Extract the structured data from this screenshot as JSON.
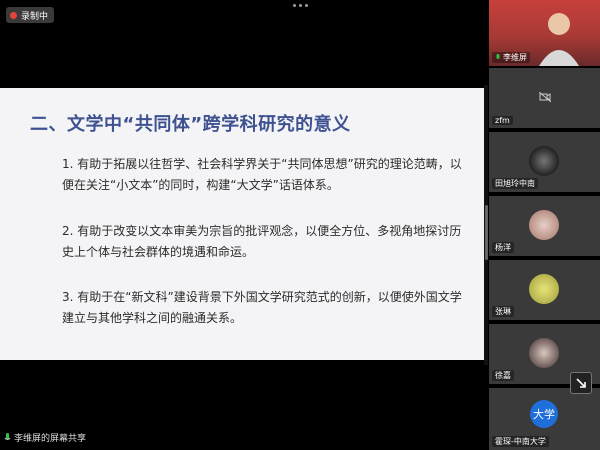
{
  "recording": {
    "label": "录制中"
  },
  "slide": {
    "title": "二、文学中“共同体”跨学科研究的意义",
    "points": [
      "1. 有助于拓展以往哲学、社会科学界关于“共同体思想”研究的理论范畴，以便在关注“小文本”的同时，构建“大文学”话语体系。",
      "2. 有助于改变以文本审美为宗旨的批评观念，以便全方位、多视角地探讨历史上个体与社会群体的境遇和命运。",
      "3. 有助于在“新文科”建设背景下外国文学研究范式的创新，以便使外国文学建立与其他学科之间的融通关系。"
    ]
  },
  "share_label": "李维屏的屏幕共享",
  "participants": [
    {
      "name": "李维屏",
      "icon": "person-video-icon"
    },
    {
      "name": "zfm",
      "icon": "camera-off-icon"
    },
    {
      "name": "田旭玲中南",
      "icon": "avatar-icon"
    },
    {
      "name": "杨洋",
      "icon": "avatar-icon"
    },
    {
      "name": "张琳",
      "icon": "avatar-icon"
    },
    {
      "name": "徐嘉",
      "icon": "avatar-icon"
    },
    {
      "name": "霍琛-中南大学",
      "avatar_text": "大学"
    }
  ],
  "colors": {
    "title": "#3e5190",
    "slide_bg": "#f4f4f6",
    "rec_dot": "#e5443b",
    "avatar_blue": "#1e6fd9"
  }
}
